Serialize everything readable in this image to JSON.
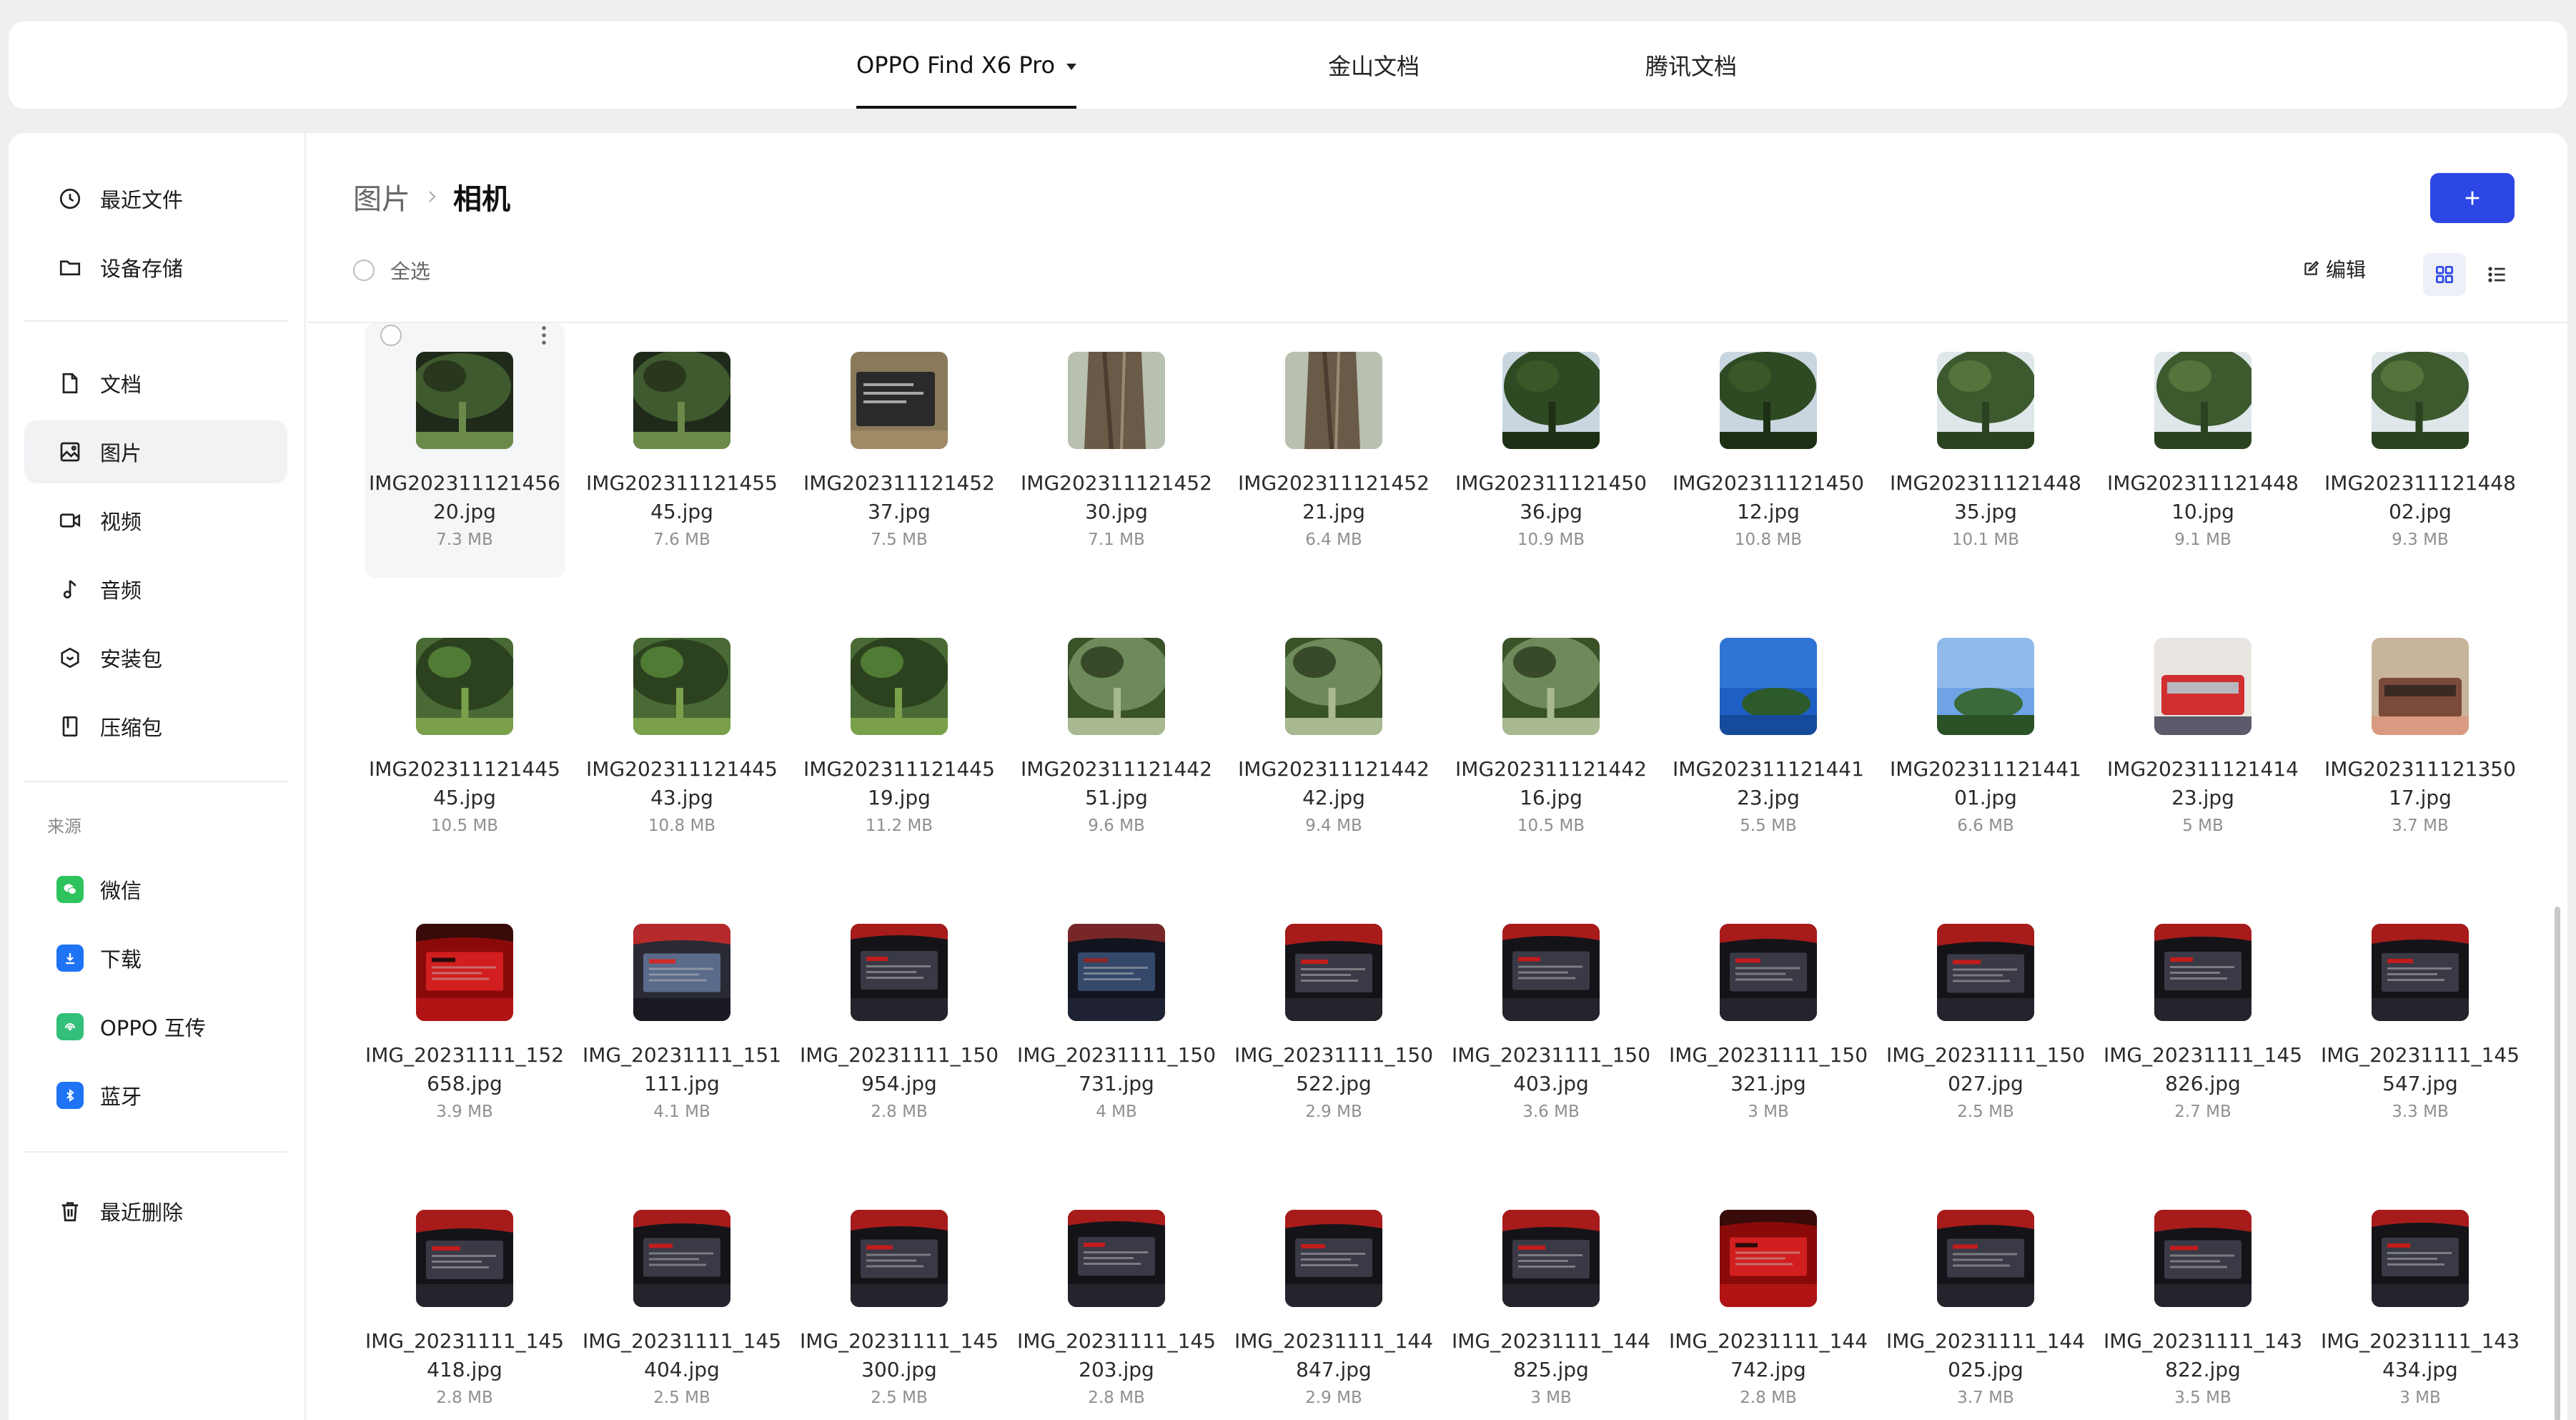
{
  "tabs": [
    {
      "label": "OPPO Find X6 Pro",
      "active": true
    },
    {
      "label": "金山文档",
      "active": false
    },
    {
      "label": "腾讯文档",
      "active": false
    }
  ],
  "sidebar": {
    "top_items": [
      {
        "label": "最近文件",
        "icon": "clock-icon"
      },
      {
        "label": "设备存储",
        "icon": "folder-icon"
      }
    ],
    "category_items": [
      {
        "label": "文档",
        "icon": "document-icon"
      },
      {
        "label": "图片",
        "icon": "image-icon",
        "active": true
      },
      {
        "label": "视频",
        "icon": "video-icon"
      },
      {
        "label": "音频",
        "icon": "music-icon"
      },
      {
        "label": "安装包",
        "icon": "package-icon"
      },
      {
        "label": "压缩包",
        "icon": "archive-icon"
      }
    ],
    "source_caption": "来源",
    "source_items": [
      {
        "label": "微信",
        "icon": "wechat-icon",
        "color": "#2ec35d"
      },
      {
        "label": "下载",
        "icon": "download-icon",
        "color": "#1e74f5"
      },
      {
        "label": "OPPO 互传",
        "icon": "oppo-share-icon",
        "color": "#33c07a"
      },
      {
        "label": "蓝牙",
        "icon": "bluetooth-icon",
        "color": "#1e74f5"
      }
    ],
    "bottom_items": [
      {
        "label": "最近删除",
        "icon": "trash-icon"
      }
    ]
  },
  "breadcrumb": {
    "parent": "图片",
    "current": "相机"
  },
  "toolbar": {
    "select_all": "全选",
    "edit": "编辑",
    "add_icon": "plus-icon"
  },
  "colors": {
    "accent": "#2d47e6"
  },
  "files": [
    {
      "line1": "IMG202311121456",
      "line2": "20.jpg",
      "size": "7.3 MB",
      "theme": "pergola",
      "selected": true
    },
    {
      "line1": "IMG202311121455",
      "line2": "45.jpg",
      "size": "7.6 MB",
      "theme": "pergola"
    },
    {
      "line1": "IMG202311121452",
      "line2": "37.jpg",
      "size": "7.5 MB",
      "theme": "sign"
    },
    {
      "line1": "IMG202311121452",
      "line2": "30.jpg",
      "size": "7.1 MB",
      "theme": "trunk"
    },
    {
      "line1": "IMG202311121452",
      "line2": "21.jpg",
      "size": "6.4 MB",
      "theme": "trunk"
    },
    {
      "line1": "IMG202311121450",
      "line2": "36.jpg",
      "size": "10.9 MB",
      "theme": "forest"
    },
    {
      "line1": "IMG202311121450",
      "line2": "12.jpg",
      "size": "10.8 MB",
      "theme": "forest"
    },
    {
      "line1": "IMG202311121448",
      "line2": "35.jpg",
      "size": "10.1 MB",
      "theme": "banyan"
    },
    {
      "line1": "IMG202311121448",
      "line2": "10.jpg",
      "size": "9.1 MB",
      "theme": "banyan"
    },
    {
      "line1": "IMG202311121448",
      "line2": "02.jpg",
      "size": "9.3 MB",
      "theme": "banyan"
    },
    {
      "line1": "IMG202311121445",
      "line2": "45.jpg",
      "size": "10.5 MB",
      "theme": "park"
    },
    {
      "line1": "IMG202311121445",
      "line2": "43.jpg",
      "size": "10.8 MB",
      "theme": "park"
    },
    {
      "line1": "IMG202311121445",
      "line2": "19.jpg",
      "size": "11.2 MB",
      "theme": "park"
    },
    {
      "line1": "IMG202311121442",
      "line2": "51.jpg",
      "size": "9.6 MB",
      "theme": "lake"
    },
    {
      "line1": "IMG202311121442",
      "line2": "42.jpg",
      "size": "9.4 MB",
      "theme": "lake"
    },
    {
      "line1": "IMG202311121442",
      "line2": "16.jpg",
      "size": "10.5 MB",
      "theme": "lake"
    },
    {
      "line1": "IMG202311121441",
      "line2": "23.jpg",
      "size": "5.5 MB",
      "theme": "sky"
    },
    {
      "line1": "IMG202311121441",
      "line2": "01.jpg",
      "size": "6.6 MB",
      "theme": "skytrees"
    },
    {
      "line1": "IMG202311121414",
      "line2": "23.jpg",
      "size": "5 MB",
      "theme": "bus"
    },
    {
      "line1": "IMG202311121350",
      "line2": "17.jpg",
      "size": "3.7 MB",
      "theme": "restaurant"
    },
    {
      "line1": "IMG_20231111_152",
      "line2": "658.jpg",
      "size": "3.9 MB",
      "theme": "stagered"
    },
    {
      "line1": "IMG_20231111_151",
      "line2": "111.jpg",
      "size": "4.1 MB",
      "theme": "stagephone"
    },
    {
      "line1": "IMG_20231111_150",
      "line2": "954.jpg",
      "size": "2.8 MB",
      "theme": "stagedark"
    },
    {
      "line1": "IMG_20231111_150",
      "line2": "731.jpg",
      "size": "4 MB",
      "theme": "stageblue"
    },
    {
      "line1": "IMG_20231111_150",
      "line2": "522.jpg",
      "size": "2.9 MB",
      "theme": "stagedark"
    },
    {
      "line1": "IMG_20231111_150",
      "line2": "403.jpg",
      "size": "3.6 MB",
      "theme": "stagedark"
    },
    {
      "line1": "IMG_20231111_150",
      "line2": "321.jpg",
      "size": "3 MB",
      "theme": "stagedark"
    },
    {
      "line1": "IMG_20231111_150",
      "line2": "027.jpg",
      "size": "2.5 MB",
      "theme": "stagedark"
    },
    {
      "line1": "IMG_20231111_145",
      "line2": "826.jpg",
      "size": "2.7 MB",
      "theme": "stagedark"
    },
    {
      "line1": "IMG_20231111_145",
      "line2": "547.jpg",
      "size": "3.3 MB",
      "theme": "stagedark"
    },
    {
      "line1": "IMG_20231111_145",
      "line2": "418.jpg",
      "size": "2.8 MB",
      "theme": "stagedark"
    },
    {
      "line1": "IMG_20231111_145",
      "line2": "404.jpg",
      "size": "2.5 MB",
      "theme": "stagedark"
    },
    {
      "line1": "IMG_20231111_145",
      "line2": "300.jpg",
      "size": "2.5 MB",
      "theme": "stagedark"
    },
    {
      "line1": "IMG_20231111_145",
      "line2": "203.jpg",
      "size": "2.8 MB",
      "theme": "stagedark"
    },
    {
      "line1": "IMG_20231111_144",
      "line2": "847.jpg",
      "size": "2.9 MB",
      "theme": "stagedark"
    },
    {
      "line1": "IMG_20231111_144",
      "line2": "825.jpg",
      "size": "3 MB",
      "theme": "stagedark"
    },
    {
      "line1": "IMG_20231111_144",
      "line2": "742.jpg",
      "size": "2.8 MB",
      "theme": "stagered"
    },
    {
      "line1": "IMG_20231111_144",
      "line2": "025.jpg",
      "size": "3.7 MB",
      "theme": "stagedark"
    },
    {
      "line1": "IMG_20231111_143",
      "line2": "822.jpg",
      "size": "3.5 MB",
      "theme": "stagedark"
    },
    {
      "line1": "IMG_20231111_143",
      "line2": "434.jpg",
      "size": "3 MB",
      "theme": "stagedark"
    }
  ]
}
